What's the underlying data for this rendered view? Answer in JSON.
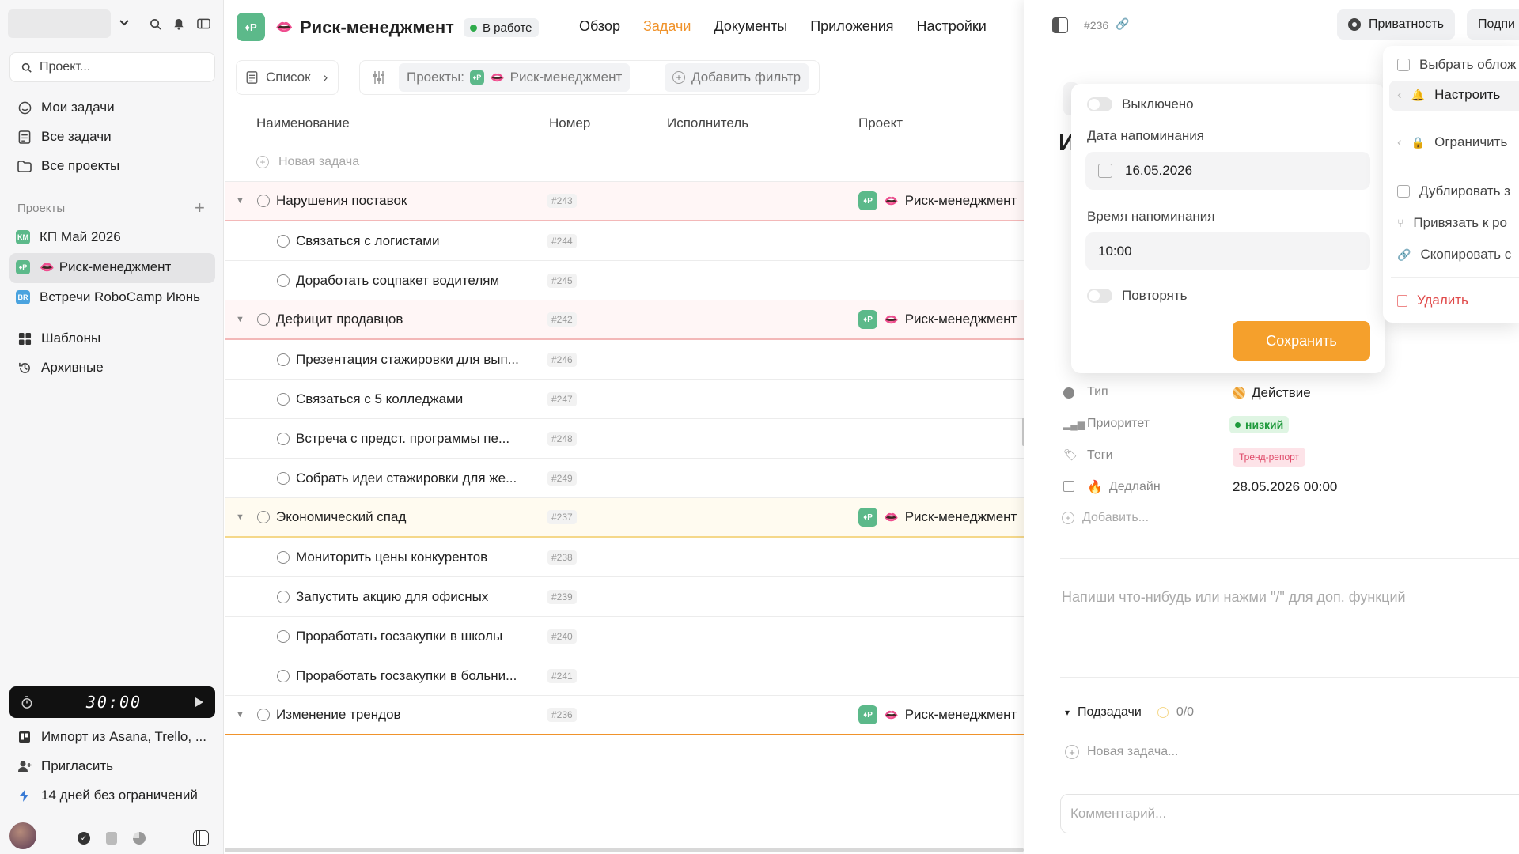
{
  "sidebar": {
    "search_placeholder": "Проект...",
    "nav": [
      {
        "label": "Мои задачи",
        "icon": "smile-icon"
      },
      {
        "label": "Все задачи",
        "icon": "list-icon"
      },
      {
        "label": "Все проекты",
        "icon": "folder-icon"
      }
    ],
    "projects_title": "Проекты",
    "projects": [
      {
        "label": "КП Май 2026",
        "badge": "KM",
        "color": "#5cb98a"
      },
      {
        "label": "Риск-менеджмент",
        "badge": "♦P",
        "color": "#5cb98a"
      },
      {
        "label": "Встречи RoboCamp Июнь",
        "badge": "BR",
        "color": "#4aa3df"
      }
    ],
    "extra": [
      {
        "label": "Шаблоны"
      },
      {
        "label": "Архивные"
      }
    ],
    "timer": "30:00",
    "bottom": [
      {
        "label": "Импорт из Asana, Trello, ..."
      },
      {
        "label": "Пригласить"
      },
      {
        "label": "14 дней без ограничений"
      }
    ]
  },
  "header": {
    "badge": "♦P",
    "title": "Риск-менеджмент",
    "status": "В работе",
    "tabs": [
      "Обзор",
      "Задачи",
      "Документы",
      "Приложения",
      "Настройки"
    ],
    "active_tab": "Задачи",
    "accent": "#f0932b"
  },
  "filters": {
    "view": "Список",
    "projects_label": "Проекты:",
    "project_value": "Риск-менеджмент",
    "add_filter": "Добавить фильтр"
  },
  "table": {
    "columns": [
      "Наименование",
      "Номер",
      "Исполнитель",
      "Проект"
    ],
    "new_task": "Новая задача",
    "project_name": "Риск-менеджмент",
    "rows": [
      {
        "name": "Нарушения поставок",
        "num": "#243",
        "parent": true,
        "color": "#f3b8b8"
      },
      {
        "name": "Связаться с логистами",
        "num": "#244",
        "parent": false
      },
      {
        "name": "Доработать соцпакет водителям",
        "num": "#245",
        "parent": false
      },
      {
        "name": "Дефицит продавцов",
        "num": "#242",
        "parent": true,
        "color": "#f3b8b8"
      },
      {
        "name": "Презентация стажировки для вып...",
        "num": "#246",
        "parent": false
      },
      {
        "name": "Связаться с 5 колледжами",
        "num": "#247",
        "parent": false
      },
      {
        "name": "Встреча с предст. программы пе...",
        "num": "#248",
        "parent": false
      },
      {
        "name": "Собрать идеи стажировки для же...",
        "num": "#249",
        "parent": false
      },
      {
        "name": "Экономический спад",
        "num": "#237",
        "parent": true,
        "color": "#f5d88a"
      },
      {
        "name": "Мониторить цены конкурентов",
        "num": "#238",
        "parent": false
      },
      {
        "name": "Запустить акцию для офисных",
        "num": "#239",
        "parent": false
      },
      {
        "name": "Проработать госзакупки в школы",
        "num": "#240",
        "parent": false
      },
      {
        "name": "Проработать госзакупки в больни...",
        "num": "#241",
        "parent": false
      },
      {
        "name": "Изменение трендов",
        "num": "#236",
        "parent": true,
        "color": "#f0932b"
      }
    ]
  },
  "panel": {
    "task_id": "#236",
    "privacy": "Приватность",
    "subscribe": "Подпи",
    "props": [
      {
        "label": "Тип",
        "value": "Действие"
      },
      {
        "label": "Приоритет",
        "value": "низкий"
      },
      {
        "label": "Теги",
        "value": "Тренд-репорт"
      },
      {
        "label": "Дедлайн",
        "value": "28.05.2026 00:00"
      }
    ],
    "add_prop": "Добавить...",
    "editor_placeholder": "Напиши что-нибудь или нажми \"/\" для доп. функций",
    "subtasks_label": "Подзадачи",
    "subtasks_count": "0/0",
    "new_subtask": "Новая задача...",
    "comment_placeholder": "Комментарий..."
  },
  "reminder": {
    "enabled_label": "Выключено",
    "date_label": "Дата напоминания",
    "date_value": "16.05.2026",
    "time_label": "Время напоминания",
    "time_value": "10:00",
    "repeat_label": "Повторять",
    "save": "Сохранить"
  },
  "context_menu": {
    "items": [
      {
        "label": "Выбрать облож"
      },
      {
        "label": "Настроить"
      },
      {
        "label": "Ограничить"
      },
      {
        "label": "Дублировать з"
      },
      {
        "label": "Привязать к ро"
      },
      {
        "label": "Скопировать с"
      },
      {
        "label": "Удалить"
      }
    ]
  }
}
